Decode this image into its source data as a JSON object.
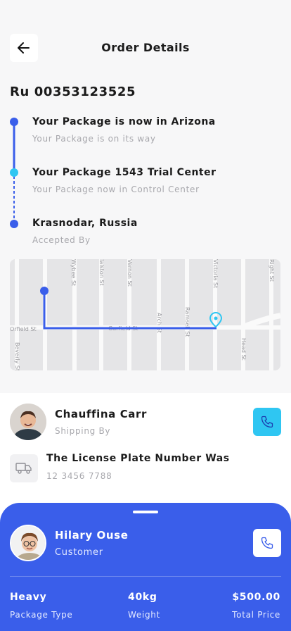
{
  "header": {
    "title": "Order Details"
  },
  "order": {
    "id": "Ru 00353123525"
  },
  "timeline": [
    {
      "title": "Your Package is now in Arizona",
      "subtitle": "Your Package is on its way"
    },
    {
      "title": "Your Package 1543 Trial Center",
      "subtitle": "Your Package now in Control Center"
    },
    {
      "title": "Krasnodar, Russia",
      "subtitle": "Accepted By"
    }
  ],
  "map": {
    "streets": [
      "Wybee St",
      "Ialston St",
      "Vernon St",
      "Arch St",
      "Ramsell St",
      "Victoria St",
      "Head St",
      "Right St",
      "Garfield St",
      "Orfield St",
      "Beverly St"
    ]
  },
  "driver": {
    "name": "Chauffina Carr",
    "role": "Shipping By"
  },
  "vehicle": {
    "label": "The License Plate Number Was",
    "plate": "12 3456 7788"
  },
  "customer": {
    "name": "Hilary Ouse",
    "role": "Customer"
  },
  "stats": [
    {
      "value": "Heavy",
      "label": "Package Type"
    },
    {
      "value": "40kg",
      "label": "Weight"
    },
    {
      "value": "$500.00",
      "label": "Total Price"
    }
  ],
  "colors": {
    "primary": "#3a5eea",
    "accent_cyan": "#2fc6f2",
    "muted_text": "#a8a8ad"
  },
  "icons": {
    "back": "arrow-left-icon",
    "phone": "phone-icon",
    "truck": "truck-icon",
    "pin": "location-pin-icon"
  }
}
